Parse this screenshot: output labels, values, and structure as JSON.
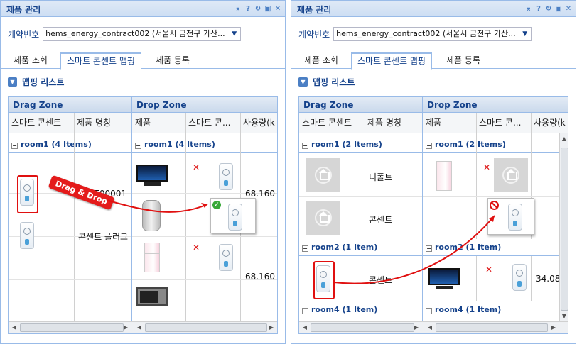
{
  "panels": [
    {
      "title": "제품 관리",
      "contract_label": "계약번호",
      "contract_value": "hems_energy_contract002 (서울시 금천구 가산...",
      "tabs": [
        {
          "label": "제품 조회"
        },
        {
          "label": "스마트 콘센트 맵핑"
        },
        {
          "label": "제품 등록"
        }
      ],
      "active_tab": 1,
      "section_title": "맵핑 리스트",
      "drag_zone": {
        "title": "Drag Zone",
        "col1": "스마트 콘센트",
        "col2": "제품 명칭"
      },
      "drop_zone": {
        "title": "Drop Zone",
        "col1": "제품",
        "col2": "스마트 콘...",
        "col3": "사용량(k"
      },
      "groups": [
        {
          "drag": "room1 (4 Items)",
          "drop": "room1 (4 Items)"
        }
      ],
      "drag_rows": [
        "TEST00001",
        "콘센트 플러그"
      ],
      "drop_rows": [
        "68.160",
        "68.160"
      ],
      "drag_label": "Drag & Drop"
    },
    {
      "title": "제품 관리",
      "contract_label": "계약번호",
      "contract_value": "hems_energy_contract002 (서울시 금천구 가산...",
      "tabs": [
        {
          "label": "제품 조회"
        },
        {
          "label": "스마트 콘센트 맵핑"
        },
        {
          "label": "제품 등록"
        }
      ],
      "active_tab": 1,
      "section_title": "맵핑 리스트",
      "drag_zone": {
        "title": "Drag Zone",
        "col1": "스마트 콘센트",
        "col2": "제품 명칭"
      },
      "drop_zone": {
        "title": "Drop Zone",
        "col1": "제품",
        "col2": "스마트 콘...",
        "col3": "사용량(k"
      },
      "groups": [
        {
          "drag": "room1 (2 Items)",
          "drop": "room1 (2 Items)"
        },
        {
          "drag": "room2 (1 Item)",
          "drop": "room2 (1 Item)"
        },
        {
          "drag": "room4 (1 Item)",
          "drop": "room4 (1 Item)"
        }
      ],
      "drag_rows": [
        "디폴트",
        "콘센트",
        "콘센트"
      ],
      "drop_rows": [
        "34.080"
      ]
    }
  ],
  "colors": {
    "accent": "#15428b",
    "border": "#99bbe8",
    "highlight": "#e01010"
  },
  "icons": [
    "collapse-icon",
    "help-icon",
    "refresh-icon",
    "maximize-icon",
    "close-icon"
  ]
}
